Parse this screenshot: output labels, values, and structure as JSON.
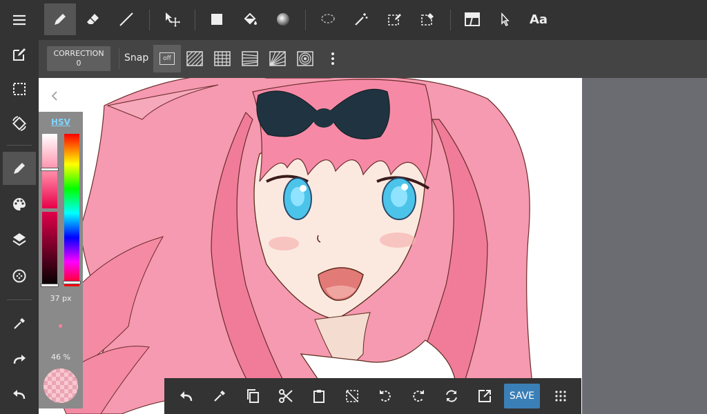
{
  "toolbar": {
    "text_tool_label": "Aa",
    "icons": [
      "pen-icon",
      "eraser-icon",
      "line-icon",
      "move-icon",
      "fill-rect-icon",
      "bucket-icon",
      "gradient-icon",
      "lasso-icon",
      "magic-wand-icon",
      "select-pen-icon",
      "select-eraser-icon",
      "panel-icon",
      "operation-icon",
      "text-icon"
    ]
  },
  "subbar": {
    "correction_label": "CORRECTION",
    "correction_value": "0",
    "snap_label": "Snap",
    "snap_off_label": "off"
  },
  "sidebar": {
    "icons": [
      "menu-icon",
      "edit-icon",
      "selection-icon",
      "rotate-canvas-icon",
      "pen-icon",
      "palette-icon",
      "layers-icon",
      "material-icon",
      "eyedropper-icon",
      "redo-icon",
      "undo-icon"
    ]
  },
  "color_panel": {
    "mode_tab": "HSV",
    "brush_size": "37 px",
    "opacity": "46 %",
    "current_color": "#f8c8d0",
    "saturation_level": 0.47,
    "value_level": 1.0,
    "hue_level": 0.98
  },
  "bottom_bar": {
    "save_label": "SAVE",
    "icons": [
      "undo-icon",
      "eyedropper-icon",
      "copy-icon",
      "cut-icon",
      "paste-icon",
      "deselect-icon",
      "rotate-left-icon",
      "rotate-right-icon",
      "flip-icon",
      "export-icon",
      "grid-menu-icon"
    ]
  },
  "colors": {
    "accent": "#3b7fb7",
    "hsv_tab": "#7fd6ff",
    "toolbar_bg": "#333333",
    "canvas_bg": "#ffffff"
  }
}
